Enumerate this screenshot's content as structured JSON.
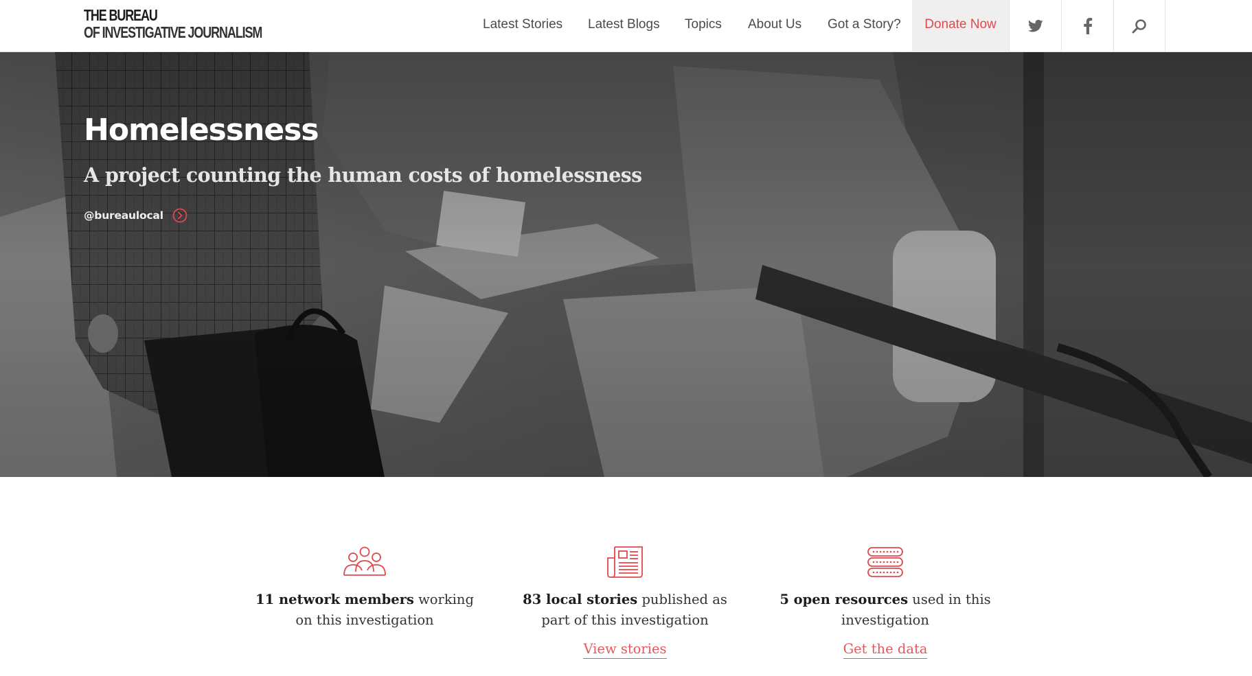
{
  "header": {
    "logo": {
      "line1": "THE BUREAU",
      "line2": "OF INVESTIGATIVE JOURNALISM"
    },
    "nav": {
      "items": [
        {
          "label": "Latest Stories"
        },
        {
          "label": "Latest Blogs"
        },
        {
          "label": "Topics"
        },
        {
          "label": "About Us"
        },
        {
          "label": "Got a Story?"
        }
      ],
      "donate_label": "Donate Now",
      "icons": [
        "twitter-icon",
        "facebook-icon",
        "search-icon"
      ]
    }
  },
  "hero": {
    "title": "Homelessness",
    "subtitle": "A project counting the human costs of homelessness",
    "handle": "@bureaulocal",
    "handle_icon": "arrow-circle-icon",
    "image_tone": "grayscale photograph"
  },
  "stats": [
    {
      "icon": "people-icon",
      "bold": "11 network members",
      "rest": "working on this investigation"
    },
    {
      "icon": "newspaper-icon",
      "bold": "83 local stories",
      "rest": "published as part of this investigation",
      "link": "View stories"
    },
    {
      "icon": "database-icon",
      "bold": "5 open resources",
      "rest": "used in this investigation",
      "link": "Get the data"
    }
  ],
  "colors": {
    "accent": "#e2474b",
    "nav_text": "#4a4a4a",
    "donate_bg": "#efefef",
    "hero_title": "#ffffff"
  }
}
